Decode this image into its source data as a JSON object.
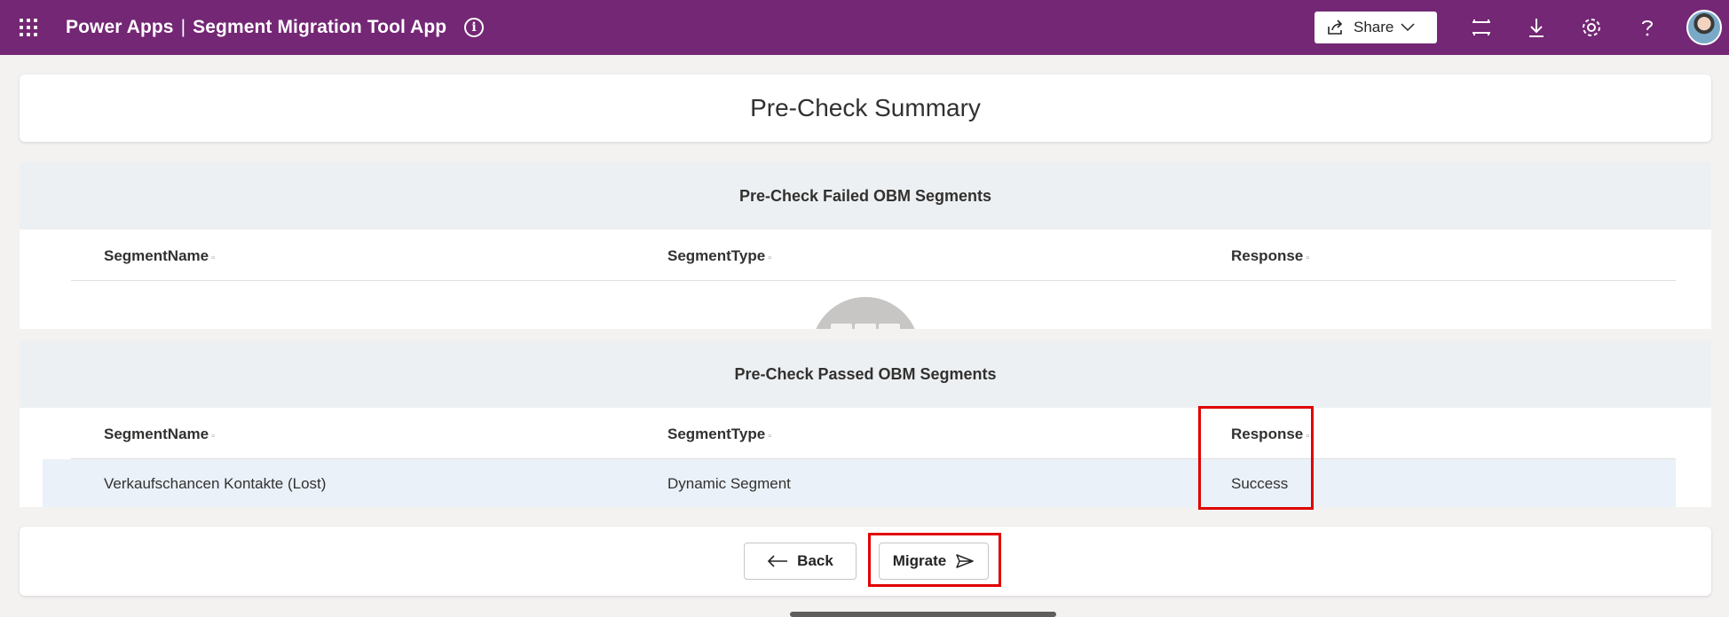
{
  "header": {
    "app_name": "Power Apps",
    "separator": "|",
    "app_title": "Segment Migration Tool App",
    "share_label": "Share",
    "accent": "#742774",
    "icons": [
      "waffle-icon",
      "info-icon",
      "share-icon",
      "chevron-down-icon",
      "fit-screen-icon",
      "download-icon",
      "settings-icon",
      "help-icon",
      "avatar"
    ]
  },
  "summary": {
    "title": "Pre-Check Summary"
  },
  "failed_section": {
    "title": "Pre-Check Failed OBM Segments",
    "columns": [
      "SegmentName",
      "SegmentType",
      "Response"
    ],
    "rows": []
  },
  "passed_section": {
    "title": "Pre-Check Passed OBM Segments",
    "columns": [
      "SegmentName",
      "SegmentType",
      "Response"
    ],
    "rows": [
      {
        "segment_name": "Verkaufschancen Kontakte (Lost)",
        "segment_type": "Dynamic Segment",
        "response": "Success"
      }
    ]
  },
  "footer": {
    "back_label": "Back",
    "migrate_label": "Migrate"
  },
  "highlight_color": "#e00000"
}
